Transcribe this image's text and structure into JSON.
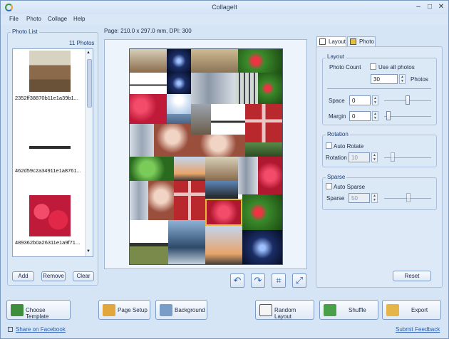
{
  "window": {
    "title": "CollageIt"
  },
  "menu": [
    "File",
    "Photo",
    "Collage",
    "Help"
  ],
  "photo_list": {
    "title": "Photo List",
    "count": "11 Photos",
    "items": [
      {
        "caption": "2352ff38870b11e1a39b1..."
      },
      {
        "caption": "462d59c2a34911e1a8761..."
      },
      {
        "caption": "489362b0a26311e1a9f71..."
      }
    ],
    "add_label": "Add",
    "remove_label": "Remove",
    "clear_label": "Clear"
  },
  "page_info": "Page: 210.0 x 297.0 mm, DPI: 300",
  "tabs": [
    {
      "label": "Layout"
    },
    {
      "label": "Photo"
    }
  ],
  "layout": {
    "group_label": "Layout",
    "photo_count_label": "Photo Count",
    "use_all_label": "Use all photos",
    "photos_value": "30",
    "photos_label": "Photos",
    "space_label": "Space",
    "space_value": "0",
    "margin_label": "Margin",
    "margin_value": "0"
  },
  "rotation": {
    "group_label": "Rotation",
    "auto_label": "Auto Rotate",
    "rotation_label": "Rotation",
    "rotation_value": "10"
  },
  "sparse": {
    "group_label": "Sparse",
    "auto_label": "Auto Sparse",
    "sparse_label": "Sparse",
    "sparse_value": "50"
  },
  "reset_label": "Reset",
  "bottom_buttons": {
    "choose_template": "Choose Template",
    "page_setup": "Page Setup",
    "background": "Background",
    "random_layout": "Random Layout",
    "shuffle": "Shuffle",
    "export": "Export"
  },
  "links": {
    "facebook": "Share on Facebook",
    "feedback": "Submit Feedback"
  },
  "icons": {
    "undo": "undo-arrow-icon",
    "redo": "redo-arrow-icon",
    "crop": "crop-icon",
    "fit": "fit-to-page-icon"
  }
}
